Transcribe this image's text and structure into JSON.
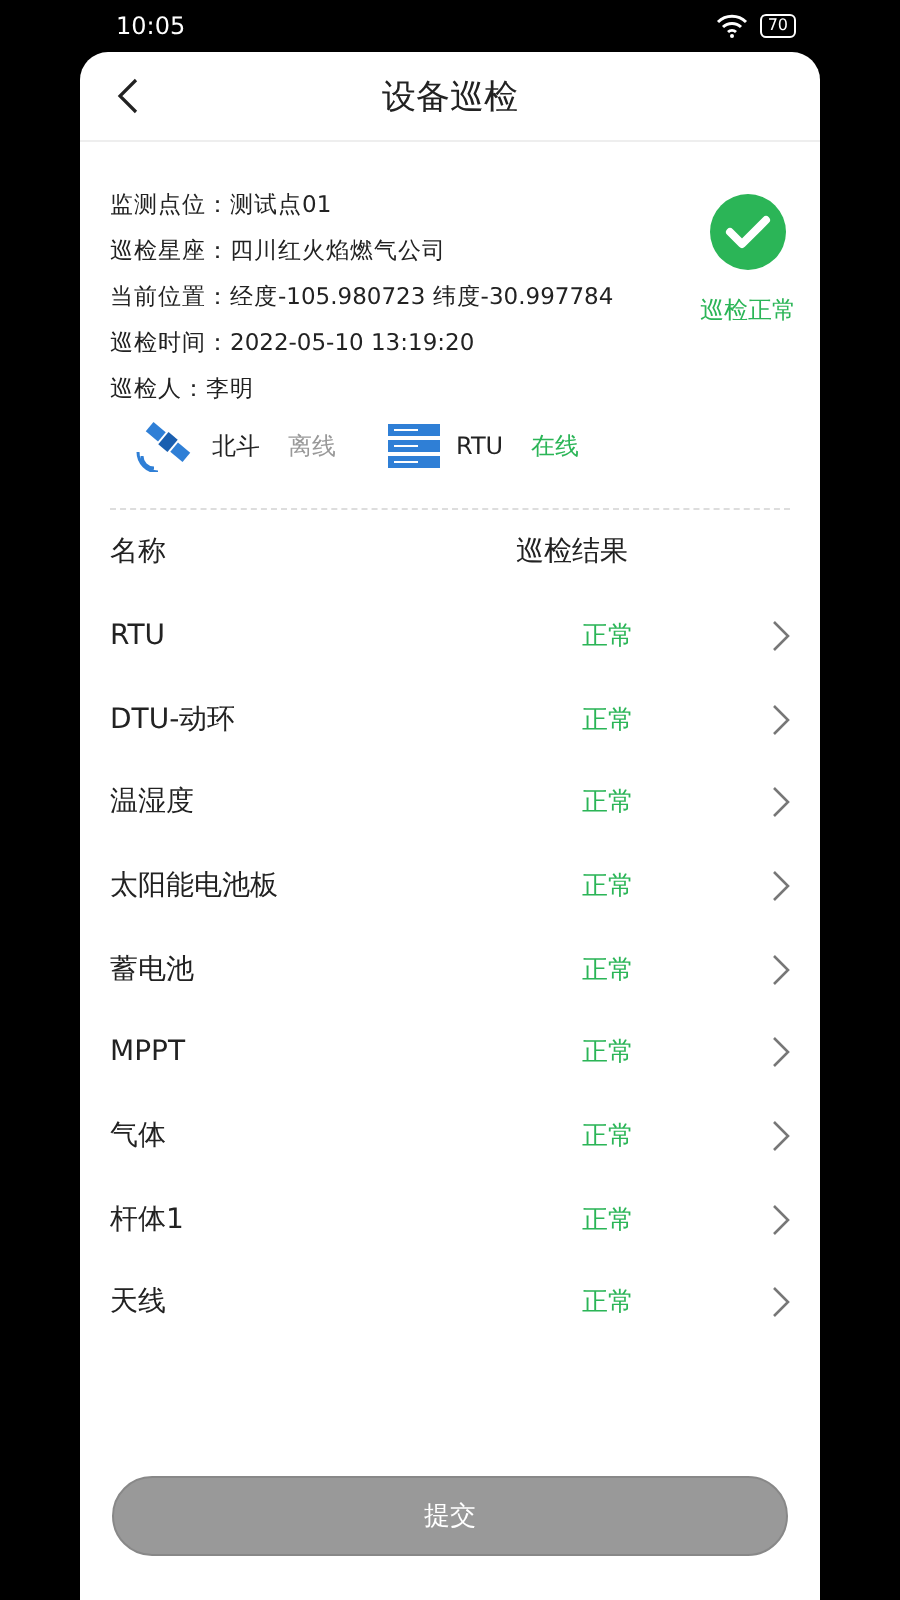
{
  "status_bar": {
    "time": "10:05",
    "battery": "70"
  },
  "header": {
    "title": "设备巡检"
  },
  "info": [
    {
      "label": "监测点位：",
      "value": "测试点01"
    },
    {
      "label": "巡检星座：",
      "value": "四川红火焰燃气公司"
    },
    {
      "label": "当前位置：",
      "value": "经度-105.980723  纬度-30.997784"
    },
    {
      "label": "巡检时间：",
      "value": "2022-05-10 13:19:20"
    },
    {
      "label": "巡检人：",
      "value": "李明"
    }
  ],
  "result_badge": {
    "text": "巡检正常",
    "ok": true
  },
  "links": [
    {
      "kind": "satellite",
      "name": "北斗",
      "status": "离线",
      "online": false
    },
    {
      "kind": "server",
      "name": "RTU",
      "status": "在线",
      "online": true
    }
  ],
  "table": {
    "columns": [
      "名称",
      "巡检结果"
    ],
    "rows": [
      {
        "name": "RTU",
        "result": "正常",
        "ok": true
      },
      {
        "name": "DTU-动环",
        "result": "正常",
        "ok": true
      },
      {
        "name": "温湿度",
        "result": "正常",
        "ok": true
      },
      {
        "name": "太阳能电池板",
        "result": "正常",
        "ok": true
      },
      {
        "name": "蓄电池",
        "result": "正常",
        "ok": true
      },
      {
        "name": "MPPT",
        "result": "正常",
        "ok": true
      },
      {
        "name": "气体",
        "result": "正常",
        "ok": true
      },
      {
        "name": "杆体1",
        "result": "正常",
        "ok": true
      },
      {
        "name": "天线",
        "result": "正常",
        "ok": true
      }
    ]
  },
  "submit_button": {
    "label": "提交",
    "disabled": true
  }
}
